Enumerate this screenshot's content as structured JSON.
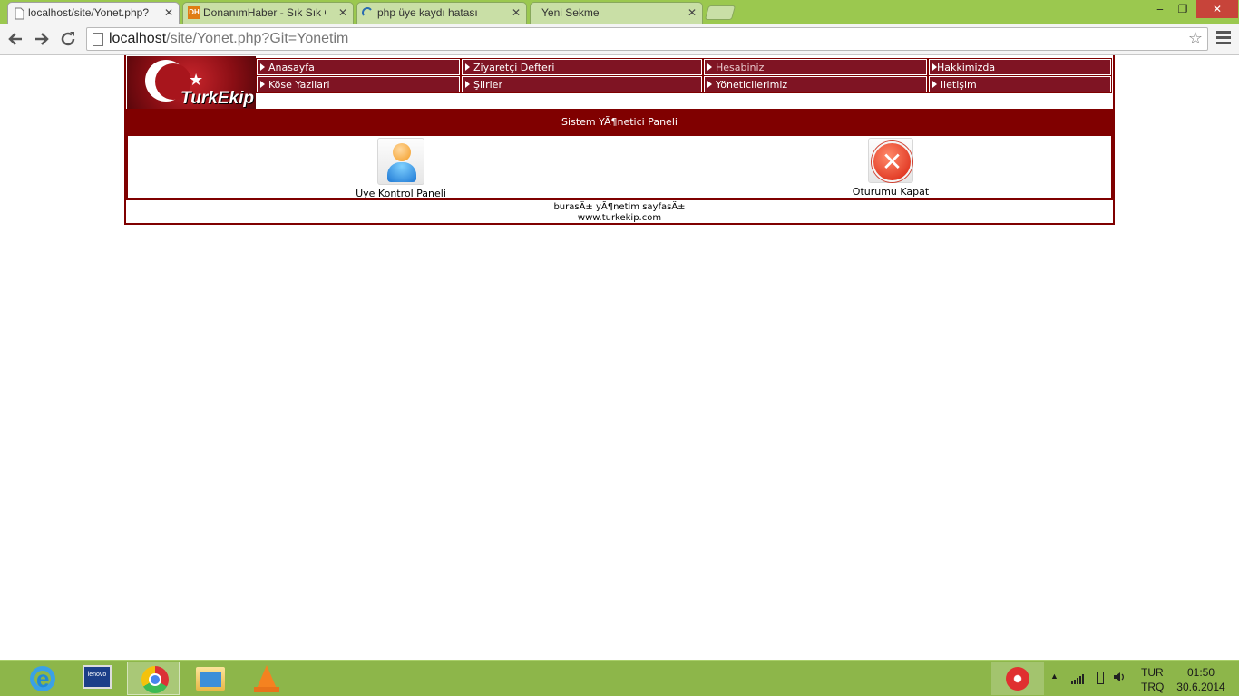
{
  "browser": {
    "tabs": [
      {
        "title": "localhost/site/Yonet.php?",
        "active": true
      },
      {
        "title": "DonanımHaber - Sık Sık G",
        "favicon_label": "DH",
        "active": false
      },
      {
        "title": "php üye kaydı hatası",
        "active": false
      },
      {
        "title": "Yeni Sekme",
        "active": false
      }
    ],
    "close_glyph": "✕",
    "address": {
      "host": "localhost",
      "path": "/site/Yonet.php?Git=Yonetim"
    },
    "star_glyph": "☆",
    "window_controls": {
      "minimize": "‒",
      "maximize": "❐",
      "close": "✕"
    }
  },
  "site": {
    "logo_text": "TurkEkip",
    "menu_rows": [
      [
        "Anasayfa",
        "Ziyaretçi Defteri",
        "Hesabiniz",
        "Hakkimizda"
      ],
      [
        "Köse Yazilari",
        "Şiirler",
        "Yöneticilerimiz",
        "iletişim"
      ]
    ],
    "panel_title": "Sistem YÃ¶netici Paneli",
    "panel_items": [
      {
        "label": "Uye Kontrol Paneli",
        "icon": "user-icon"
      },
      {
        "label": "Oturumu Kapat",
        "icon": "close-x-icon"
      }
    ],
    "footer_line1": "burasÄ± yÃ¶netim sayfasÄ±",
    "footer_line2": "www.turkekip.com"
  },
  "taskbar": {
    "apps": [
      "internet-explorer",
      "lenovo",
      "chrome",
      "file-explorer",
      "vlc"
    ],
    "lenovo_label": "lenovo",
    "language": "TUR",
    "keyboard": "TRQ",
    "time": "01:50",
    "date": "30.6.2014",
    "tray_arrow": "▲"
  },
  "colors": {
    "brand_dark_red": "#800000",
    "menu_red": "#7f1423",
    "tabbar_green": "#9bc84f",
    "taskbar_green": "#8db64a"
  }
}
